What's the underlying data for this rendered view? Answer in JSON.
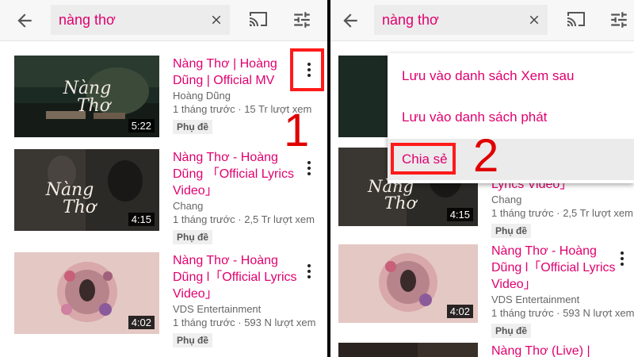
{
  "search": {
    "query": "nàng thơ"
  },
  "videos": [
    {
      "title": "Nàng Thơ | Hoàng Dũng | Official MV",
      "channel": "Hoàng Dũng",
      "meta": "1 tháng trước · 15 Tr lượt xem",
      "badge": "Phụ đề",
      "duration": "5:22"
    },
    {
      "title": "Nàng Thơ - Hoàng Dũng 「Official Lyrics Video」",
      "channel": "Chang",
      "meta": "1 tháng trước · 2,5 Tr lượt xem",
      "badge": "Phụ đề",
      "duration": "4:15"
    },
    {
      "title": "Nàng Thơ - Hoàng Dũng l「Official Lyrics Video」",
      "channel": "VDS Entertainment",
      "meta": "1 tháng trước · 593 N lượt xem",
      "badge": "Phụ đề",
      "duration": "4:02"
    },
    {
      "title": "Nàng Thơ (Live) |"
    }
  ],
  "right_partial": {
    "row2_title_tail": "Lyrics Video」"
  },
  "menu": {
    "items": [
      "Lưu vào danh sách Xem sau",
      "Lưu vào danh sách phát",
      "Chia sẻ"
    ]
  },
  "steps": {
    "one": "1",
    "two": "2"
  },
  "colors": {
    "accent": "#e0006f",
    "highlight": "#ff1a1a"
  },
  "icons": {
    "back": "arrow-left",
    "clear": "close",
    "cast": "cast",
    "filter": "tune",
    "more": "more-vertical"
  }
}
